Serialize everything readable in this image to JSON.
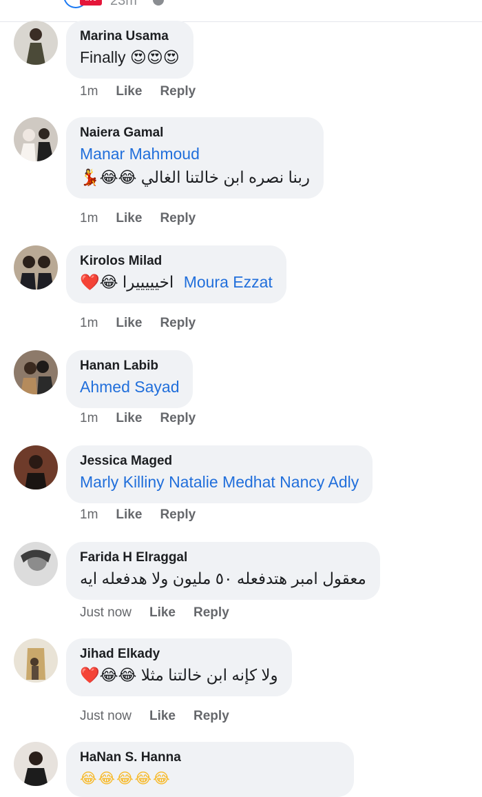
{
  "header": {
    "badge": "live",
    "time": "23m"
  },
  "comments": [
    {
      "name": "Marina Usama",
      "mention": "",
      "text": "Finally 😍😍😍",
      "time": "1m",
      "like": "Like",
      "reply": "Reply"
    },
    {
      "name": "Naiera Gamal",
      "mention": "Manar Mahmoud",
      "text": "ربنا نصره ابن خالتنا الغالي 😂😂💃",
      "time": "1m",
      "like": "Like",
      "reply": "Reply"
    },
    {
      "name": "Kirolos Milad",
      "mention": "Moura Ezzat",
      "text": "اخيييييرا 😂❤️",
      "time": "1m",
      "like": "Like",
      "reply": "Reply"
    },
    {
      "name": "Hanan Labib",
      "mention": "Ahmed Sayad",
      "text": "",
      "time": "1m",
      "like": "Like",
      "reply": "Reply"
    },
    {
      "name": "Jessica Maged",
      "mention": "Marly Killiny Natalie Medhat Nancy Adly",
      "text": "",
      "time": "1m",
      "like": "Like",
      "reply": "Reply"
    },
    {
      "name": "Farida H Elraggal",
      "mention": "",
      "text": "معقول امبر هتدفعله ٥٠ مليون ولا هدفعله ايه",
      "time": "Just now",
      "like": "Like",
      "reply": "Reply"
    },
    {
      "name": "Jihad Elkady",
      "mention": "",
      "text": "ولا كإنه ابن خالتنا مثلا 😂😂❤️",
      "time": "Just now",
      "like": "Like",
      "reply": "Reply"
    },
    {
      "name": "HaNan S. Hanna",
      "mention": "",
      "text": "",
      "time": "",
      "like": "",
      "reply": ""
    }
  ]
}
